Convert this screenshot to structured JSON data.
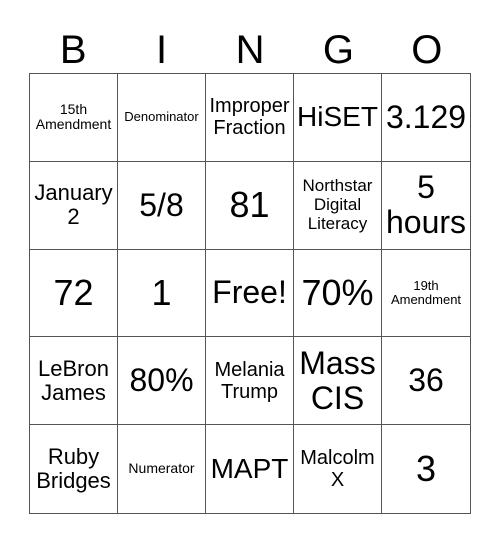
{
  "header": [
    "B",
    "I",
    "N",
    "G",
    "O"
  ],
  "cells": [
    [
      "15th\nAmendment",
      "Denominator",
      "Improper\nFraction",
      "HiSET",
      "3.129"
    ],
    [
      "January\n2",
      "5/8",
      "81",
      "Northstar\nDigital\nLiteracy",
      "5\nhours"
    ],
    [
      "72",
      "1",
      "Free!",
      "70%",
      "19th\nAmendment"
    ],
    [
      "LeBron\nJames",
      "80%",
      "Melania\nTrump",
      "Mass\nCIS",
      "36"
    ],
    [
      "Ruby\nBridges",
      "Numerator",
      "MAPT",
      "Malcolm\nX",
      "3"
    ]
  ]
}
